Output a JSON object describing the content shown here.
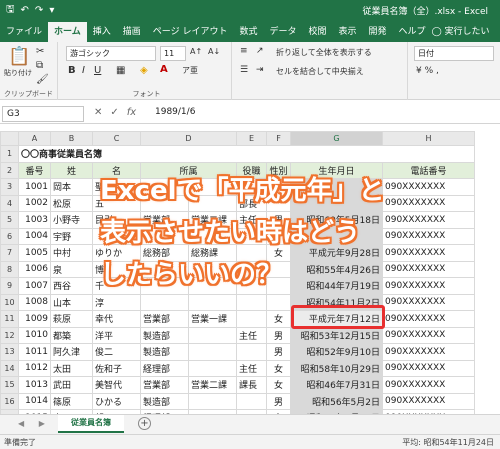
{
  "window": {
    "title": "従業員名簿（全）.xlsx  -  Excel"
  },
  "qat": {
    "save": "🖫",
    "undo": "↶",
    "redo": "↷",
    "customize": "▾"
  },
  "tabs": [
    "ファイル",
    "ホーム",
    "挿入",
    "描画",
    "ページ レイアウト",
    "数式",
    "データ",
    "校閲",
    "表示",
    "開発",
    "ヘルプ"
  ],
  "tellme": "◯ 実行したい作業を",
  "ribbon": {
    "paste_label": "貼り付け",
    "clipboard_label": "クリップボード",
    "font_name": "游ゴシック",
    "font_size": "11",
    "font_label": "フォント",
    "bold": "B",
    "italic": "I",
    "underline": "U",
    "wrap_text": "折り返して全体を表示する",
    "merge_center": "セルを結合して中央揃え",
    "number_format": "日付"
  },
  "formula_bar": {
    "name_box": "G3",
    "fx": "fx",
    "value": "1989/1/6"
  },
  "sheet": {
    "columns": [
      "A",
      "B",
      "C",
      "D",
      "E",
      "F",
      "G",
      "H"
    ],
    "title": "〇〇商事従業員名簿",
    "headers": [
      "番号",
      "姓",
      "名",
      "所属",
      "",
      "役職",
      "性別",
      "生年月日",
      "電話番号"
    ],
    "rows": [
      {
        "n": "3",
        "cells": [
          "1001",
          "岡本",
          "聖",
          "",
          "",
          "",
          "",
          "",
          "090XXXXXXX"
        ]
      },
      {
        "n": "4",
        "cells": [
          "1002",
          "松原",
          "五",
          "",
          "",
          "部長",
          "",
          "",
          "090XXXXXXX"
        ]
      },
      {
        "n": "5",
        "cells": [
          "1003",
          "小野寺",
          "昆引",
          "営業部",
          "営業二課",
          "主任",
          "男",
          "昭和60年5月18日",
          "090XXXXXXX"
        ]
      },
      {
        "n": "6",
        "cells": [
          "1004",
          "宇野",
          "",
          "",
          "",
          "",
          "",
          "",
          "090XXXXXXX"
        ]
      },
      {
        "n": "7",
        "cells": [
          "1005",
          "中村",
          "ゆりか",
          "総務部",
          "総務課",
          "",
          "女",
          "平成元年9月28日",
          "090XXXXXXX"
        ]
      },
      {
        "n": "8",
        "cells": [
          "1006",
          "泉",
          "博",
          "",
          "",
          "",
          "",
          "昭和55年4月26日",
          "090XXXXXXX"
        ]
      },
      {
        "n": "9",
        "cells": [
          "1007",
          "西谷",
          "千",
          "",
          "",
          "",
          "",
          "昭和44年7月19日",
          "090XXXXXXX"
        ]
      },
      {
        "n": "10",
        "cells": [
          "1008",
          "山本",
          "淳",
          "",
          "",
          "",
          "",
          "昭和54年11月2日",
          "090XXXXXXX"
        ]
      },
      {
        "n": "11",
        "cells": [
          "1009",
          "萩原",
          "幸代",
          "営業部",
          "営業一課",
          "",
          "女",
          "平成元年7月12日",
          "090XXXXXXX"
        ]
      },
      {
        "n": "12",
        "cells": [
          "1010",
          "都築",
          "洋平",
          "製造部",
          "",
          "主任",
          "男",
          "昭和53年12月15日",
          "090XXXXXXX"
        ]
      },
      {
        "n": "13",
        "cells": [
          "1011",
          "阿久津",
          "俊二",
          "製造部",
          "",
          "",
          "男",
          "昭和52年9月10日",
          "090XXXXXXX"
        ]
      },
      {
        "n": "14",
        "cells": [
          "1012",
          "太田",
          "佐和子",
          "経理部",
          "",
          "主任",
          "女",
          "昭和58年10月29日",
          "090XXXXXXX"
        ]
      },
      {
        "n": "15",
        "cells": [
          "1013",
          "武田",
          "美智代",
          "営業部",
          "営業二課",
          "課長",
          "女",
          "昭和46年7月31日",
          "090XXXXXXX"
        ]
      },
      {
        "n": "16",
        "cells": [
          "1014",
          "篠原",
          "ひかる",
          "製造部",
          "",
          "",
          "男",
          "昭和56年5月2日",
          "090XXXXXXX"
        ]
      },
      {
        "n": "17",
        "cells": [
          "1015",
          "小川",
          "望",
          "経理部",
          "",
          "",
          "女",
          "昭和63年3月12日",
          "090XXXXXXX"
        ]
      }
    ]
  },
  "overlay": {
    "line1": "Excelで「平成元年」と",
    "line2": "表示させたい時はどう",
    "line3": "したらいいの？"
  },
  "sheet_tabs": {
    "nav": "◀ ▶",
    "active": "従業員名簿",
    "add": "+"
  },
  "status": {
    "left": "準備完了",
    "right": "平均: 昭和54年11月24日"
  },
  "colors": {
    "excel_green": "#217346",
    "overlay_outline": "#f0722d",
    "highlight_border": "#e8302f"
  }
}
